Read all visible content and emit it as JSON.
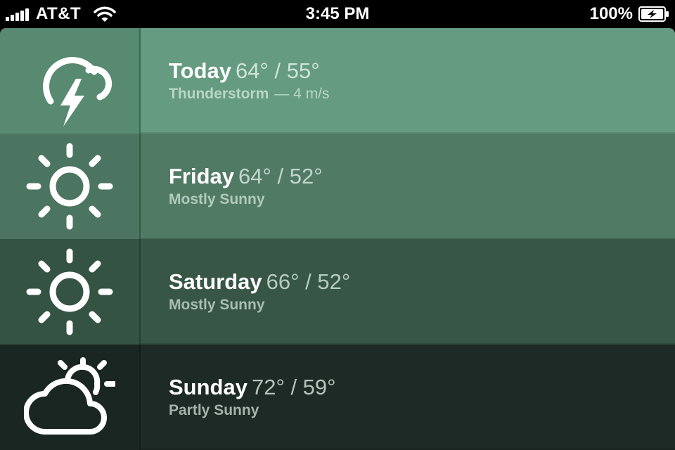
{
  "status_bar": {
    "carrier": "AT&T",
    "time": "3:45 PM",
    "battery": "100%",
    "signal_icon": "signal-bars-icon",
    "wifi_icon": "wifi-icon",
    "battery_icon": "battery-charging-icon"
  },
  "forecast": [
    {
      "day": "Today",
      "temps": "64° / 55°",
      "condition": "Thunderstorm",
      "wind": "— 4 m/s",
      "icon": "thunderstorm-icon"
    },
    {
      "day": "Friday",
      "temps": "64° / 52°",
      "condition": "Mostly Sunny",
      "icon": "sun-icon"
    },
    {
      "day": "Saturday",
      "temps": "66° / 52°",
      "condition": "Mostly Sunny",
      "icon": "sun-icon"
    },
    {
      "day": "Sunday",
      "temps": "72° / 59°",
      "condition": "Partly Sunny",
      "icon": "partly-sunny-icon"
    }
  ],
  "colors": {
    "today": "#659b80",
    "friday": "#517a65",
    "saturday": "#375646",
    "sunday": "#1d2a25"
  }
}
